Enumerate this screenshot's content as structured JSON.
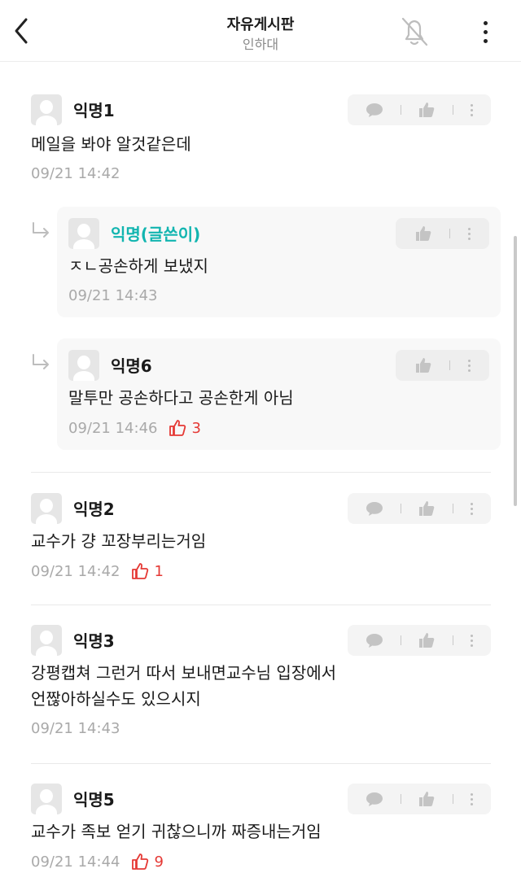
{
  "header": {
    "title": "자유게시판",
    "subtitle": "인하대"
  },
  "comments": [
    {
      "name": "익명1",
      "text": "메일을 봐야 알것같은데",
      "time": "09/21 14:42"
    },
    {
      "name": "익명2",
      "text": "교수가 걍 꼬장부리는거임",
      "time": "09/21 14:42",
      "likes": "1"
    },
    {
      "name": "익명3",
      "text_line1": "강평캡쳐 그런거 따서 보내면교수님 입장에서",
      "text_line2": "언짢아하실수도 있으시지",
      "time": "09/21 14:43"
    },
    {
      "name": "익명5",
      "text": "교수가 족보 얻기 귀찮으니까 짜증내는거임",
      "time": "09/21 14:44",
      "likes": "9"
    }
  ],
  "replies": [
    {
      "name": "익명(글쓴이)",
      "text": "ㅈㄴ공손하게 보냈지",
      "time": "09/21 14:43"
    },
    {
      "name": "익명6",
      "text": "말투만 공손하다고 공손한게 아님",
      "time": "09/21 14:46",
      "likes": "3"
    }
  ],
  "colors": {
    "writer": "#12b5b0",
    "like": "#e53935",
    "meta": "#a9a9a9"
  },
  "icons": {
    "back": "chevron-left-icon",
    "bell": "bell-off-icon",
    "more": "more-vertical-icon",
    "comment": "speech-bubble-icon",
    "like": "thumbs-up-icon",
    "reply": "reply-arrow-icon"
  }
}
